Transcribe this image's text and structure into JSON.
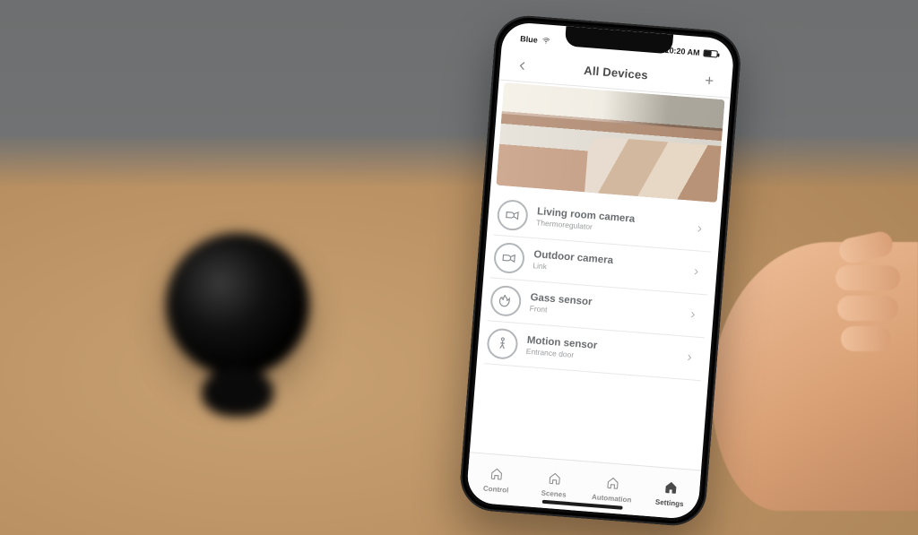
{
  "status_bar": {
    "carrier": "Blue",
    "time": "10:20 AM"
  },
  "nav": {
    "title": "All Devices"
  },
  "devices": [
    {
      "name": "Living room camera",
      "sub": "Thermoregulator",
      "icon": "camera"
    },
    {
      "name": "Outdoor camera",
      "sub": "Link",
      "icon": "camera"
    },
    {
      "name": "Gass sensor",
      "sub": "Front",
      "icon": "flame"
    },
    {
      "name": "Motion sensor",
      "sub": "Entrance door",
      "icon": "motion"
    }
  ],
  "tabs": [
    {
      "label": "Control",
      "active": false
    },
    {
      "label": "Scenes",
      "active": false
    },
    {
      "label": "Automation",
      "active": false
    },
    {
      "label": "Settings",
      "active": true
    }
  ]
}
